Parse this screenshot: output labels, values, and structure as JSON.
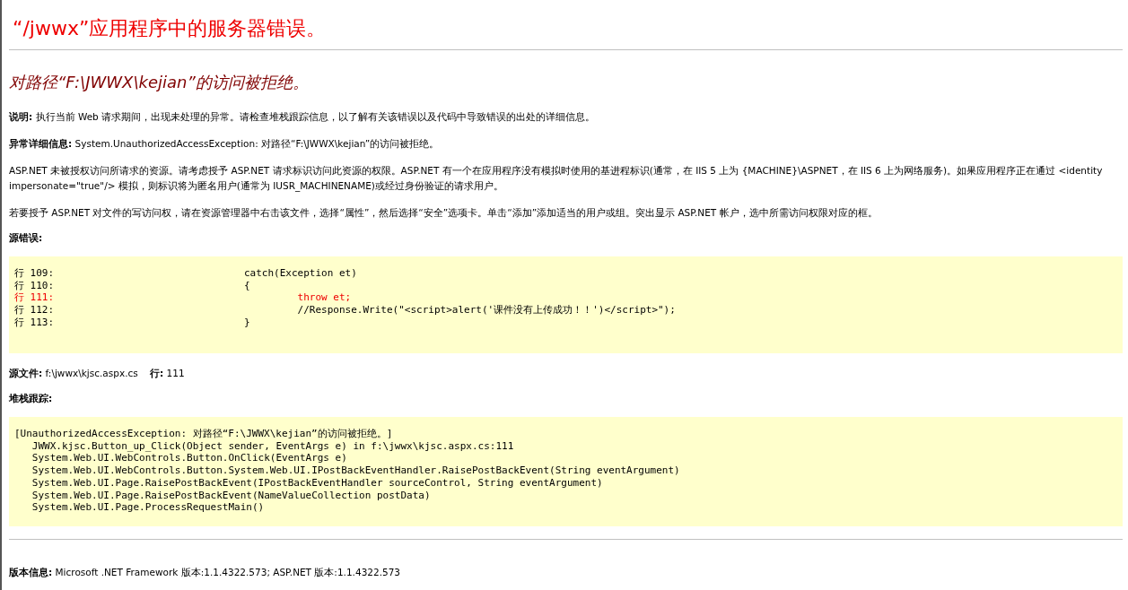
{
  "title": "“/jwwx”应用程序中的服务器错误。",
  "subtitle": "对路径“F:\\JWWX\\kejian”的访问被拒绝。",
  "paragraphs": [
    "**说明:** 执行当前 Web 请求期间，出现未处理的异常。请检查堆栈跟踪信息，以了解有关该错误以及代码中导致错误的出处的详细信息。",
    "**异常详细信息:** System.UnauthorizedAccessException: 对路径“F:\\JWWX\\kejian”的访问被拒绝。",
    "ASP.NET 未被授权访问所请求的资源。请考虑授予 ASP.NET 请求标识访问此资源的权限。ASP.NET 有一个在应用程序没有模拟时使用的基进程标识(通常，在 IIS 5 上为 {MACHINE}\\ASPNET，在 IIS 6 上为网络服务)。如果应用程序正在通过 <identity impersonate=\"true\"/> 模拟，则标识将为匿名用户(通常为 IUSR_MACHINENAME)或经过身份验证的请求用户。",
    "若要授予 ASP.NET 对文件的写访问权，请在资源管理器中右击该文件，选择“属性”，然后选择“安全”选项卡。单击“添加”添加适当的用户或组。突出显示 ASP.NET 帐户，选中所需访问权限对应的框。"
  ],
  "source_error": {
    "heading": "源错误:",
    "lines": [
      {
        "number": "行 109:",
        "code": "catch(Exception et)",
        "highlighted": false
      },
      {
        "number": "行 110:",
        "code": "{",
        "highlighted": false
      },
      {
        "number": "行 111:",
        "code": "\tthrow et;",
        "highlighted": true
      },
      {
        "number": "行 112:",
        "code": "\t//Response.Write(\"<script>alert('课件没有上传成功！！')</script>\");",
        "highlighted": false
      },
      {
        "number": "行 113:",
        "code": "}",
        "highlighted": false
      }
    ]
  },
  "source_file": "**源文件:** f:\\jwwx\\kjsc.aspx.cs    **行:** 111",
  "stack_trace": {
    "heading": "堆栈跟踪:",
    "lines": [
      "[UnauthorizedAccessException: 对路径“F:\\JWWX\\kejian”的访问被拒绝。]",
      "   JWWX.kjsc.Button_up_Click(Object sender, EventArgs e) in f:\\jwwx\\kjsc.aspx.cs:111",
      "   System.Web.UI.WebControls.Button.OnClick(EventArgs e)",
      "   System.Web.UI.WebControls.Button.System.Web.UI.IPostBackEventHandler.RaisePostBackEvent(String eventArgument)",
      "   System.Web.UI.Page.RaisePostBackEvent(IPostBackEventHandler sourceControl, String eventArgument)",
      "   System.Web.UI.Page.RaisePostBackEvent(NameValueCollection postData)",
      "   System.Web.UI.Page.ProcessRequestMain()"
    ]
  },
  "version": "**版本信息:** Microsoft .NET Framework 版本:1.1.4322.573; ASP.NET 版本:1.1.4322.573"
}
